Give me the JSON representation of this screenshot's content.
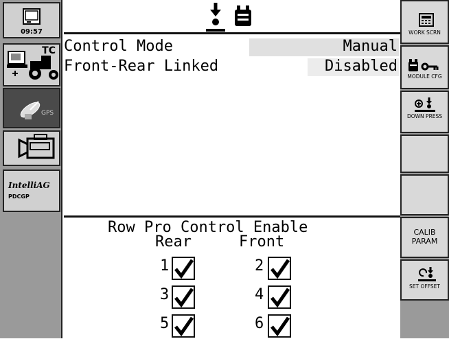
{
  "header": {
    "icon_names": [
      "down-press-icon",
      "module-icon"
    ]
  },
  "clock": {
    "time": "09:57"
  },
  "left_buttons": [
    {
      "name": "monitor-icon",
      "label": "09:57"
    },
    {
      "name": "tc-tractor-icon",
      "label": "TC"
    },
    {
      "name": "gps-icon",
      "label": "GPS"
    },
    {
      "name": "camera-icon",
      "label": ""
    },
    {
      "name": "intelliag-logo",
      "label1": "IntelliAG",
      "label2": "PDCGP"
    }
  ],
  "settings": [
    {
      "label": "Control Mode",
      "value": "Manual"
    },
    {
      "label": "Front-Rear Linked",
      "value": "Disabled"
    }
  ],
  "row_pro": {
    "title": "Row Pro Control Enable",
    "rear_label": "Rear",
    "front_label": "Front",
    "rows": [
      {
        "number": "1",
        "checked": true
      },
      {
        "number": "2",
        "checked": true
      },
      {
        "number": "3",
        "checked": true
      },
      {
        "number": "4",
        "checked": true
      },
      {
        "number": "5",
        "checked": true
      },
      {
        "number": "6",
        "checked": true
      }
    ]
  },
  "right_buttons": {
    "work_scrn": "WORK SCRN",
    "module_cfg": "MODULE CFG",
    "down_press": "DOWN PRESS",
    "calib_line1": "CALIB",
    "calib_line2": "PARAM",
    "set_offset": "SET OFFSET"
  },
  "colors": {
    "panel_gray": "#9a9a9a",
    "button_gray": "#d0d0d0",
    "gps_button_dark": "#4a4a4a"
  }
}
